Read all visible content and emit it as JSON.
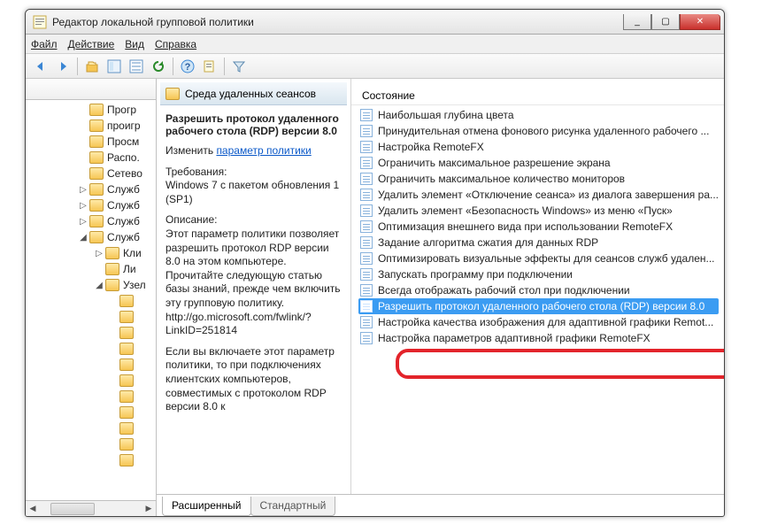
{
  "window": {
    "title": "Редактор локальной групповой политики"
  },
  "menus": {
    "file": "Файл",
    "action": "Действие",
    "view": "Вид",
    "help": "Справка"
  },
  "toolbar_icons": [
    "back",
    "forward",
    "up",
    "tree",
    "table",
    "refresh",
    "help",
    "properties",
    "filter"
  ],
  "tree": {
    "items": [
      {
        "indent": 60,
        "label": "Прогр",
        "caret": ""
      },
      {
        "indent": 60,
        "label": "проигр",
        "caret": ""
      },
      {
        "indent": 60,
        "label": "Просм",
        "caret": ""
      },
      {
        "indent": 60,
        "label": "Распо.",
        "caret": ""
      },
      {
        "indent": 60,
        "label": "Сетево",
        "caret": ""
      },
      {
        "indent": 60,
        "label": "Служб",
        "caret": "▷"
      },
      {
        "indent": 60,
        "label": "Служб",
        "caret": "▷"
      },
      {
        "indent": 60,
        "label": "Служб",
        "caret": "▷"
      },
      {
        "indent": 60,
        "label": "Служб",
        "caret": "◢"
      },
      {
        "indent": 78,
        "label": "Кли",
        "caret": "▷"
      },
      {
        "indent": 78,
        "label": "Ли",
        "caret": ""
      },
      {
        "indent": 78,
        "label": "Узел",
        "caret": "◢"
      },
      {
        "indent": 94,
        "label": "",
        "caret": ""
      },
      {
        "indent": 94,
        "label": "",
        "caret": ""
      },
      {
        "indent": 94,
        "label": "",
        "caret": ""
      },
      {
        "indent": 94,
        "label": "",
        "caret": ""
      },
      {
        "indent": 94,
        "label": "",
        "caret": ""
      },
      {
        "indent": 94,
        "label": "",
        "caret": ""
      },
      {
        "indent": 94,
        "label": "",
        "caret": ""
      },
      {
        "indent": 94,
        "label": "",
        "caret": ""
      },
      {
        "indent": 94,
        "label": "",
        "caret": ""
      },
      {
        "indent": 94,
        "label": "",
        "caret": ""
      },
      {
        "indent": 94,
        "label": "",
        "caret": ""
      }
    ]
  },
  "desc": {
    "header": "Среда удаленных сеансов",
    "title": "Разрешить протокол удаленного рабочего стола (RDP) версии 8.0",
    "edit_label": "Изменить",
    "link_text": "параметр политики",
    "req_label": "Требования:",
    "req_text": "Windows 7 с пакетом обновления 1 (SP1)",
    "desc_label": "Описание:",
    "desc_text": "Этот параметр политики позволяет разрешить протокол RDP версии 8.0 на этом компьютере. Прочитайте следующую статью базы знаний, прежде чем включить эту групповую политику. http://go.microsoft.com/fwlink/?LinkID=251814",
    "desc_more": "Если вы включаете этот параметр политики, то при подключениях клиентских компьютеров, совместимых с протоколом RDP версии 8.0 к"
  },
  "list": {
    "header": "Состояние",
    "rows": [
      "Наибольшая глубина цвета",
      "Принудительная отмена фонового рисунка удаленного рабочего ...",
      "Настройка RemoteFX",
      "Ограничить максимальное разрешение экрана",
      "Ограничить максимальное количество мониторов",
      "Удалить элемент «Отключение сеанса» из диалога завершения ра...",
      "Удалить элемент «Безопасность Windows» из меню «Пуск»",
      "Оптимизация внешнего вида при использовании RemoteFX",
      "Задание алгоритма сжатия для данных RDP",
      "Оптимизировать визуальные эффекты для сеансов служб удален...",
      "Запускать программу при подключении",
      "Всегда отображать рабочий стол при подключении",
      "Разрешить протокол удаленного рабочего стола (RDP) версии 8.0",
      "Настройка качества изображения для адаптивной графики Remot...",
      "Настройка параметров адаптивной графики RemoteFX"
    ],
    "selected_index": 12
  },
  "tabs": {
    "extended": "Расширенный",
    "standard": "Стандартный"
  },
  "titlebar_buttons": {
    "min": "_",
    "max": "▢",
    "close": "✕"
  }
}
